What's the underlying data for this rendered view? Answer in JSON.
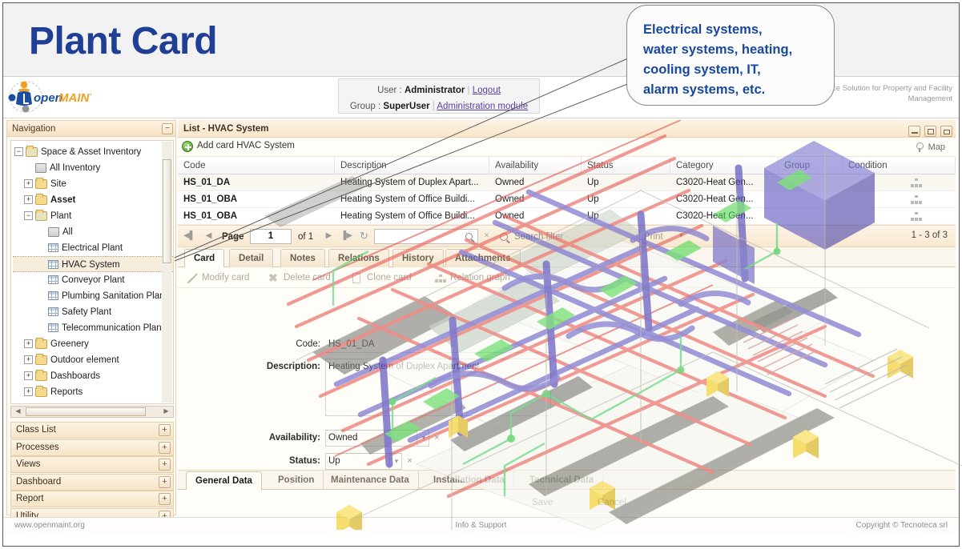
{
  "slide": {
    "title": "Plant Card"
  },
  "callout": {
    "line1": "Electrical systems,",
    "line2": "water systems, heating,",
    "line3": "cooling system, IT,",
    "line4": "alarm systems, etc.",
    "color": "#18489e"
  },
  "header": {
    "logo_alt": "openMAINT",
    "logo_open": "open",
    "logo_maint": "MAINT",
    "tagline": "Open Source Solution for Property and Facility Management",
    "user_label": "User :",
    "user_name": "Administrator",
    "logout": "Logout",
    "group_label": "Group :",
    "group_name": "SuperUser",
    "admin_module": "Administration module",
    "divider": "|"
  },
  "navigation": {
    "title": "Navigation",
    "collapse_btn": "−",
    "tree": [
      {
        "label": "Space & Asset Inventory",
        "level": 0,
        "icon": "folder-open-icon",
        "expander": "−",
        "bold": false
      },
      {
        "label": "All Inventory",
        "level": 1,
        "icon": "all-icon",
        "expander": "",
        "bold": false
      },
      {
        "label": "Site",
        "level": 1,
        "icon": "folder-icon",
        "expander": "+",
        "bold": false
      },
      {
        "label": "Asset",
        "level": 1,
        "icon": "folder-icon",
        "expander": "+",
        "bold": true
      },
      {
        "label": "Plant",
        "level": 1,
        "icon": "folder-open-icon",
        "expander": "−",
        "bold": false
      },
      {
        "label": "All",
        "level": 2,
        "icon": "all-icon",
        "expander": "",
        "bold": false
      },
      {
        "label": "Electrical Plant",
        "level": 2,
        "icon": "grid-icon",
        "expander": "",
        "bold": false
      },
      {
        "label": "HVAC System",
        "level": 2,
        "icon": "grid-icon",
        "expander": "",
        "bold": false,
        "selected": true
      },
      {
        "label": "Conveyor Plant",
        "level": 2,
        "icon": "grid-icon",
        "expander": "",
        "bold": false
      },
      {
        "label": "Plumbing Sanitation Plan",
        "level": 2,
        "icon": "grid-icon",
        "expander": "",
        "bold": false
      },
      {
        "label": "Safety Plant",
        "level": 2,
        "icon": "grid-icon",
        "expander": "",
        "bold": false
      },
      {
        "label": "Telecommunication Plan",
        "level": 2,
        "icon": "grid-icon",
        "expander": "",
        "bold": false
      },
      {
        "label": "Greenery",
        "level": 1,
        "icon": "folder-icon",
        "expander": "+",
        "bold": false
      },
      {
        "label": "Outdoor element",
        "level": 1,
        "icon": "folder-icon",
        "expander": "+",
        "bold": false
      },
      {
        "label": "Dashboards",
        "level": 1,
        "icon": "folder-icon",
        "expander": "+",
        "bold": false
      },
      {
        "label": "Reports",
        "level": 1,
        "icon": "folder-icon",
        "expander": "+",
        "bold": false
      }
    ],
    "accordion": [
      {
        "label": "Class List",
        "expand": "+"
      },
      {
        "label": "Processes",
        "expand": "+"
      },
      {
        "label": "Views",
        "expand": "+"
      },
      {
        "label": "Dashboard",
        "expand": "+"
      },
      {
        "label": "Report",
        "expand": "+"
      },
      {
        "label": "Utility",
        "expand": "+"
      }
    ]
  },
  "content": {
    "title": "List - HVAC System",
    "add_card": "Add card HVAC System",
    "map_button": "Map",
    "window_buttons": [
      "minimize",
      "maximize",
      "print"
    ]
  },
  "grid": {
    "columns": [
      "Code",
      "Description",
      "Availability",
      "Status",
      "Category",
      "Group",
      "Condition"
    ],
    "rows": [
      {
        "code": "HS_01_DA",
        "description": "Heating System of Duplex Apart...",
        "availability": "Owned",
        "status": "Up",
        "category": "C3020-Heat Gen...",
        "group": "",
        "condition": ""
      },
      {
        "code": "HS_01_OBA",
        "description": "Heating System of Office Buildi...",
        "availability": "Owned",
        "status": "Up",
        "category": "C3020-Heat Gen...",
        "group": "",
        "condition": ""
      },
      {
        "code": "HS_01_OBA",
        "description": "Heating System of Office Buildi...",
        "availability": "Owned",
        "status": "Up",
        "category": "C3020-Heat Gen...",
        "group": "",
        "condition": ""
      }
    ]
  },
  "pager": {
    "first": "◀▌",
    "prev": "◀",
    "page_label": "Page",
    "page_value": "1",
    "of_label": "of 1",
    "next": "▶",
    "last": "▐▶",
    "refresh": "↻",
    "search_placeholder": "",
    "clear": "×",
    "search_filter": "Search filter",
    "print_label": "Print",
    "range": "1 - 3 of 3"
  },
  "card": {
    "tabs": [
      "Card",
      "Detail",
      "Notes",
      "Relations",
      "History",
      "Attachments"
    ],
    "active_tab": "Card",
    "toolbar": [
      {
        "label": "Modify card",
        "icon": "pencil-icon"
      },
      {
        "label": "Delete card",
        "icon": "x-icon"
      },
      {
        "label": "Clone card",
        "icon": "document-icon"
      },
      {
        "label": "Relation graph",
        "icon": "relation-graph-icon"
      }
    ],
    "fields": {
      "code_label": "Code:",
      "code_value": "HS_01_DA",
      "description_label": "Description:",
      "description_value": "Heating System of Duplex Apartment",
      "availability_label": "Availability:",
      "availability_value": "Owned",
      "status_label": "Status:",
      "status_value": "Up"
    },
    "bottom_tabs": [
      "General Data",
      "Position",
      "Maintenance Data",
      "Installation Data",
      "Technical Data"
    ],
    "active_bottom_tab": "General Data",
    "save": "Save",
    "cancel": "Cancel"
  },
  "footer": {
    "left": "www.openmaint.org",
    "center": "Info & Support",
    "right": "Copyright © Tecnoteca srl"
  }
}
